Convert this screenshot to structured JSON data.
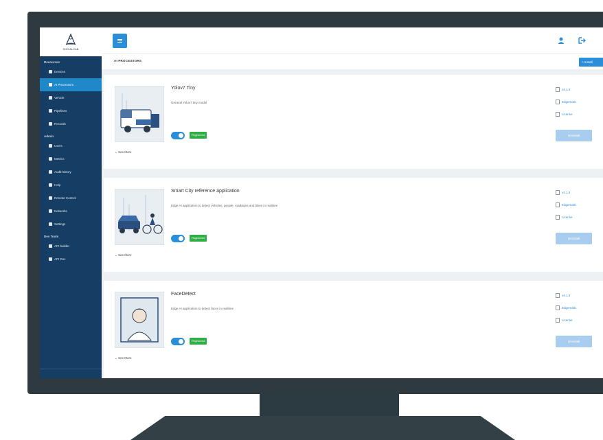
{
  "breadcrumb": "AI PROCESSORS",
  "add_button": "+ Install",
  "sidebar": {
    "logo_text": "SOCIALCAB",
    "sections": [
      {
        "title": "Resources",
        "items": [
          "Devices",
          "AI Processors",
          "Vehicle",
          "Pipelines",
          "Records"
        ]
      },
      {
        "title": "Admin",
        "items": [
          "Users",
          "Metrics",
          "Audit history",
          "Help",
          "Remote Control",
          "Networks",
          "Settings"
        ]
      },
      {
        "title": "Dev Tools",
        "items": [
          "API builder",
          "API Doc"
        ]
      }
    ],
    "active_item": "AI Processors"
  },
  "cards": [
    {
      "title": "Yolov7 Tiny",
      "description": "General Yolov7 tiny model",
      "badge": "Registered",
      "see_more": "See More",
      "links": [
        "v4.1.0",
        "Edgematic",
        "License"
      ],
      "uninstall": "Uninstall"
    },
    {
      "title": "Smart City reference application",
      "description": "Edge AI application to detect vehicles, people, roadsigns and bikes in realtime",
      "badge": "Registered",
      "see_more": "See More",
      "links": [
        "v4.1.0",
        "Edgematic",
        "License"
      ],
      "uninstall": "Uninstall"
    },
    {
      "title": "FaceDetect",
      "description": "Edge AI application to detect faces in realtime",
      "badge": "Registered",
      "see_more": "See More",
      "links": [
        "v4.1.0",
        "Edgematic",
        "License"
      ],
      "uninstall": "Uninstall"
    }
  ],
  "colors": {
    "sidebar": "#163d63",
    "accent": "#2a8fd8",
    "badge": "#2fae45",
    "monitor": "#2f3a40"
  }
}
